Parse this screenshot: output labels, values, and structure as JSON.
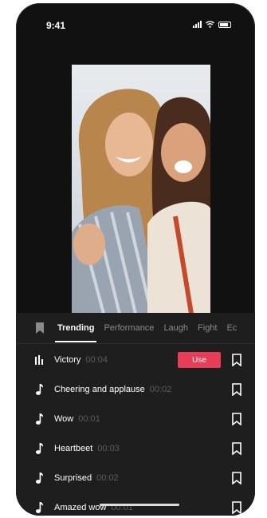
{
  "status_bar": {
    "time": "9:41"
  },
  "preview": {
    "image": "two-women-selfie-photo"
  },
  "sound_panel": {
    "tabs": [
      {
        "label": "Trending",
        "active": true
      },
      {
        "label": "Performance",
        "active": false
      },
      {
        "label": "Laugh",
        "active": false
      },
      {
        "label": "Fight",
        "active": false
      },
      {
        "label": "Ec",
        "active": false
      }
    ],
    "sounds": [
      {
        "title": "Victory",
        "duration": "00:04",
        "icon": "waveform-icon",
        "selected": true
      },
      {
        "title": "Cheering and applause",
        "duration": "00:02",
        "icon": "music-note-icon"
      },
      {
        "title": "Wow",
        "duration": "00:01",
        "icon": "music-note-icon"
      },
      {
        "title": "Heartbeet",
        "duration": "00:03",
        "icon": "music-note-icon"
      },
      {
        "title": "Surprised",
        "duration": "00:02",
        "icon": "music-note-icon"
      },
      {
        "title": "Amazed wow",
        "duration": "00:01",
        "icon": "music-note-icon"
      }
    ],
    "use_label": "Use"
  },
  "colors": {
    "accent": "#e73d57",
    "panel_bg": "#1e1e1e",
    "phone_bg": "#111111"
  }
}
